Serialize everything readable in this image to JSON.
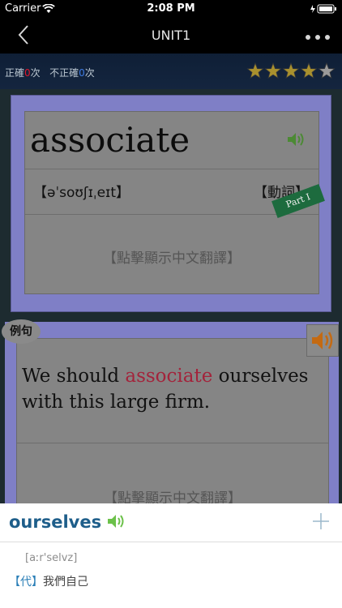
{
  "status": {
    "carrier": "Carrier",
    "time": "2:08 PM"
  },
  "nav": {
    "title": "UNIT1"
  },
  "score": {
    "correct_label": "正確",
    "correct_count": "0",
    "times": "次",
    "incorrect_label": "不正確",
    "incorrect_count": "0"
  },
  "stars": {
    "filled": 4,
    "total": 5
  },
  "word_card": {
    "word": "associate",
    "phonetic": "【əˈsoʊʃɪˌeɪt】",
    "pos": "【動詞】",
    "tap_hint": "【點擊顯示中文翻譯】",
    "part_label": "Part I"
  },
  "example_card": {
    "badge": "例句",
    "sentence_pre": "We should ",
    "sentence_highlight": "associate",
    "sentence_post": " ourselves with this large firm.",
    "tap_hint": "【點擊顯示中文翻譯】"
  },
  "popup": {
    "word": "ourselves",
    "phonetic": "[aːr'selvz]",
    "pos_tag": "【代】",
    "meaning": "我們自己"
  },
  "colors": {
    "accent_blue": "#1e5e8a",
    "highlight_red": "#a3233b",
    "card_purple": "#7f7fc6",
    "ribbon_green": "#1d6b3e"
  }
}
